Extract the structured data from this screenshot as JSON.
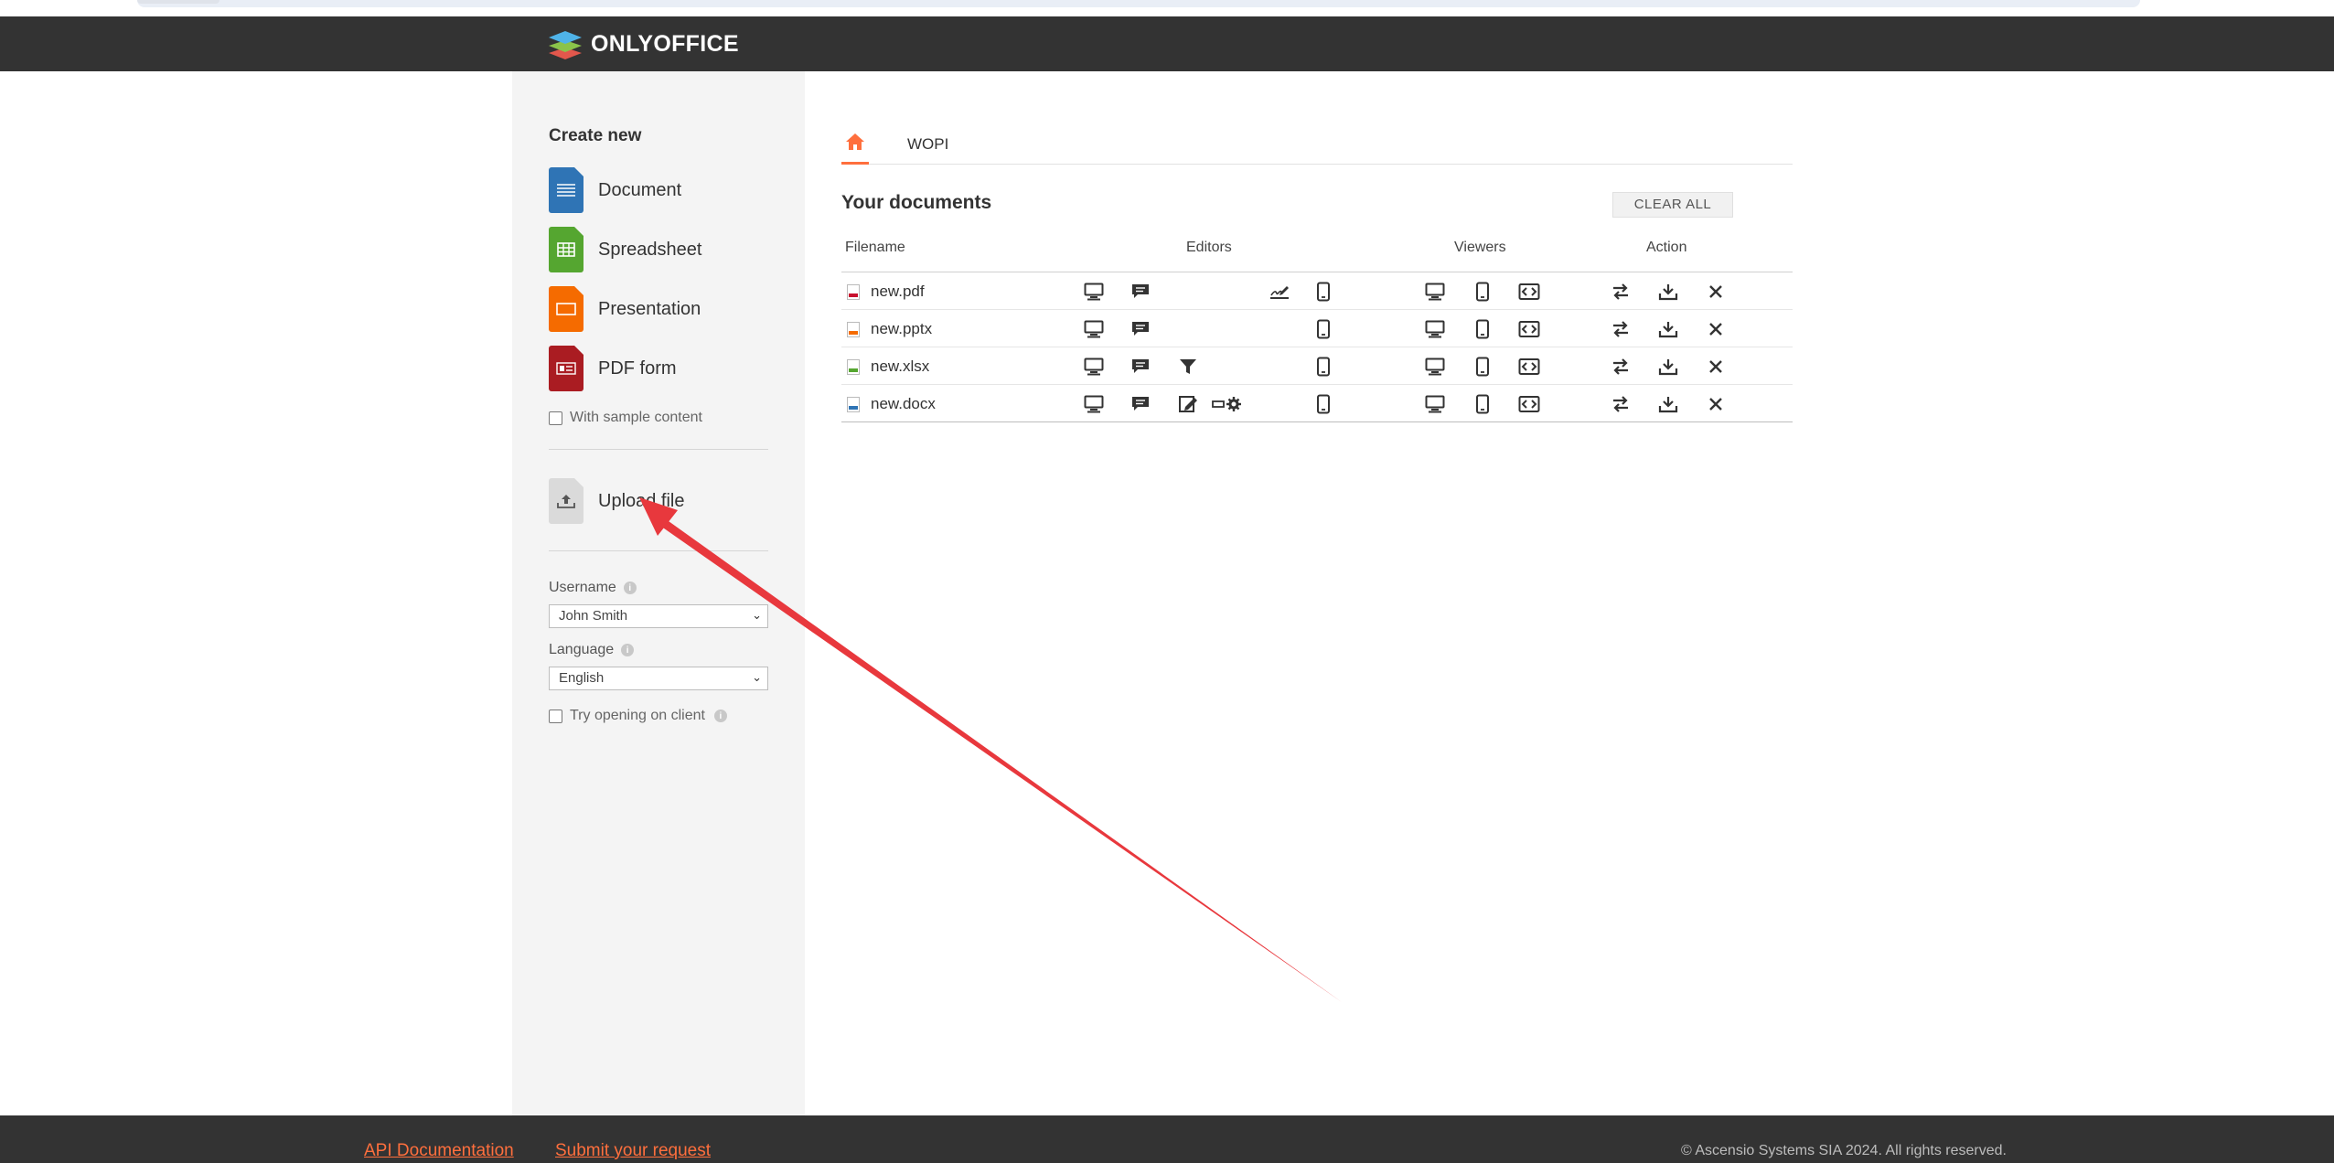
{
  "brand": {
    "name": "ONLYOFFICE"
  },
  "sidebar": {
    "create_title": "Create new",
    "create_items": [
      {
        "label": "Document",
        "icon": "document-icon",
        "color": "#2f74b5"
      },
      {
        "label": "Spreadsheet",
        "icon": "spreadsheet-icon",
        "color": "#55a630"
      },
      {
        "label": "Presentation",
        "icon": "presentation-icon",
        "color": "#f56b00"
      },
      {
        "label": "PDF form",
        "icon": "pdf-form-icon",
        "color": "#aa1c22"
      }
    ],
    "sample_content_label": "With sample content",
    "upload_label": "Upload file",
    "username_label": "Username",
    "username_value": "John Smith",
    "language_label": "Language",
    "language_value": "English",
    "try_client_label": "Try opening on client"
  },
  "main": {
    "tab_label": "WOPI",
    "docs_title": "Your documents",
    "clear_all_label": "CLEAR ALL",
    "columns": {
      "filename": "Filename",
      "editors": "Editors",
      "viewers": "Viewers",
      "action": "Action"
    },
    "files": [
      {
        "name": "new.pdf",
        "color": "#c8102e"
      },
      {
        "name": "new.pptx",
        "color": "#f56b00"
      },
      {
        "name": "new.xlsx",
        "color": "#55a630"
      },
      {
        "name": "new.docx",
        "color": "#2f74b5"
      }
    ]
  },
  "footer": {
    "api_docs": "API Documentation",
    "submit_request": "Submit your request",
    "copyright": "© Ascensio Systems SIA 2024. All rights reserved."
  },
  "colors": {
    "accent": "#ff6f3d",
    "header": "#333333",
    "annotation_arrow": "#e8383d"
  }
}
